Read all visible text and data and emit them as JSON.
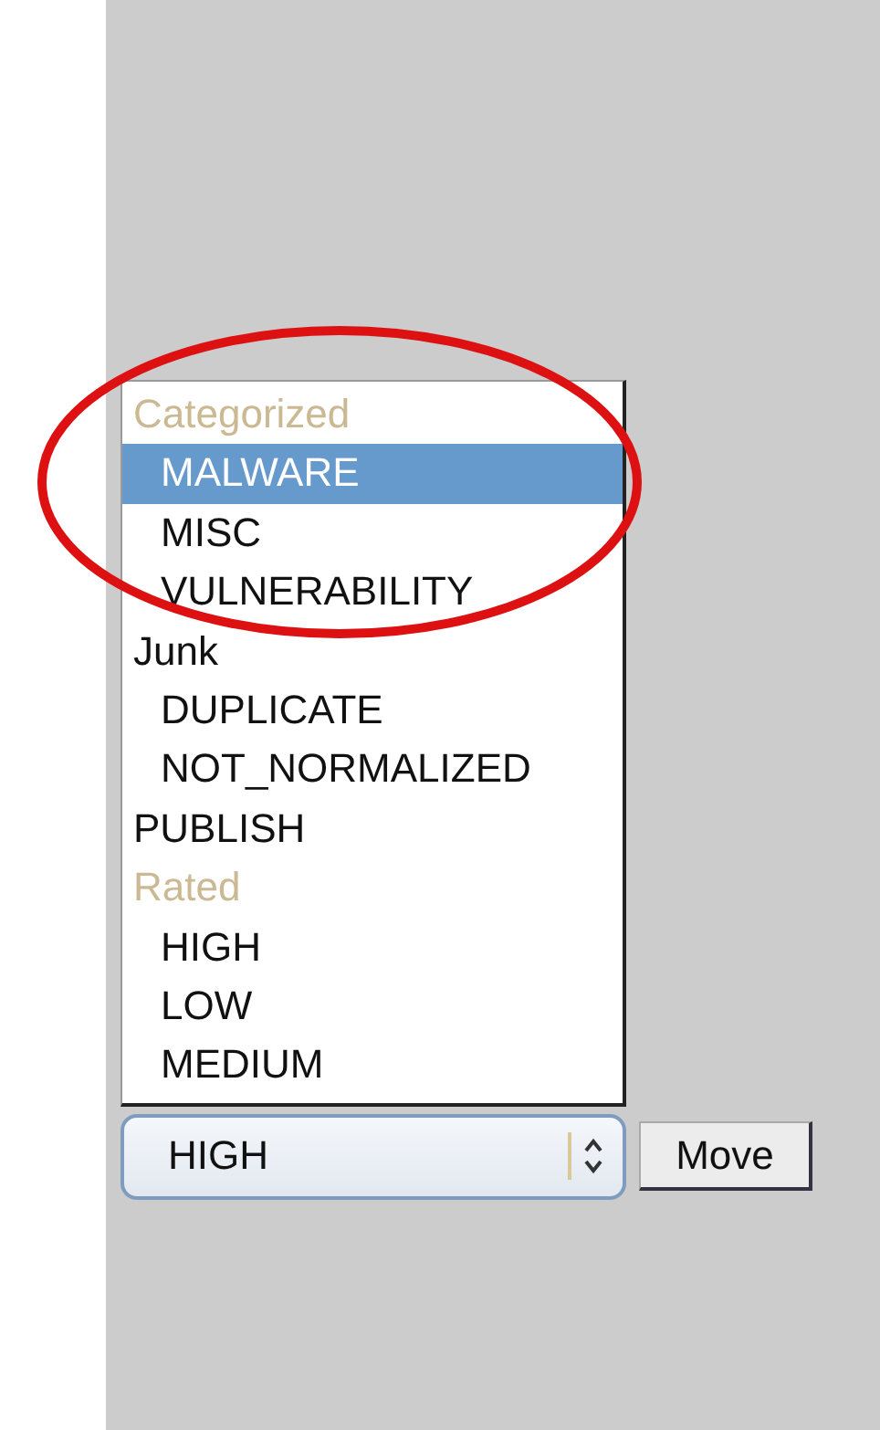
{
  "listbox": {
    "items": [
      {
        "label": "Categorized",
        "kind": "group",
        "selected": false,
        "children": [
          {
            "label": "MALWARE",
            "kind": "option",
            "selected": true
          },
          {
            "label": "MISC",
            "kind": "option",
            "selected": false
          },
          {
            "label": "VULNERABILITY",
            "kind": "option",
            "selected": false
          }
        ]
      },
      {
        "label": "Junk",
        "kind": "option",
        "selected": false,
        "children": [
          {
            "label": "DUPLICATE",
            "kind": "option",
            "selected": false
          },
          {
            "label": "NOT_NORMALIZED",
            "kind": "option",
            "selected": false
          }
        ]
      },
      {
        "label": "PUBLISH",
        "kind": "option",
        "selected": false
      },
      {
        "label": "Rated",
        "kind": "group",
        "selected": false,
        "children": [
          {
            "label": "HIGH",
            "kind": "option",
            "selected": false
          },
          {
            "label": "LOW",
            "kind": "option",
            "selected": false
          },
          {
            "label": "MEDIUM",
            "kind": "option",
            "selected": false
          }
        ]
      }
    ]
  },
  "dropdown": {
    "value": "HIGH"
  },
  "move_button": {
    "label": "Move"
  }
}
